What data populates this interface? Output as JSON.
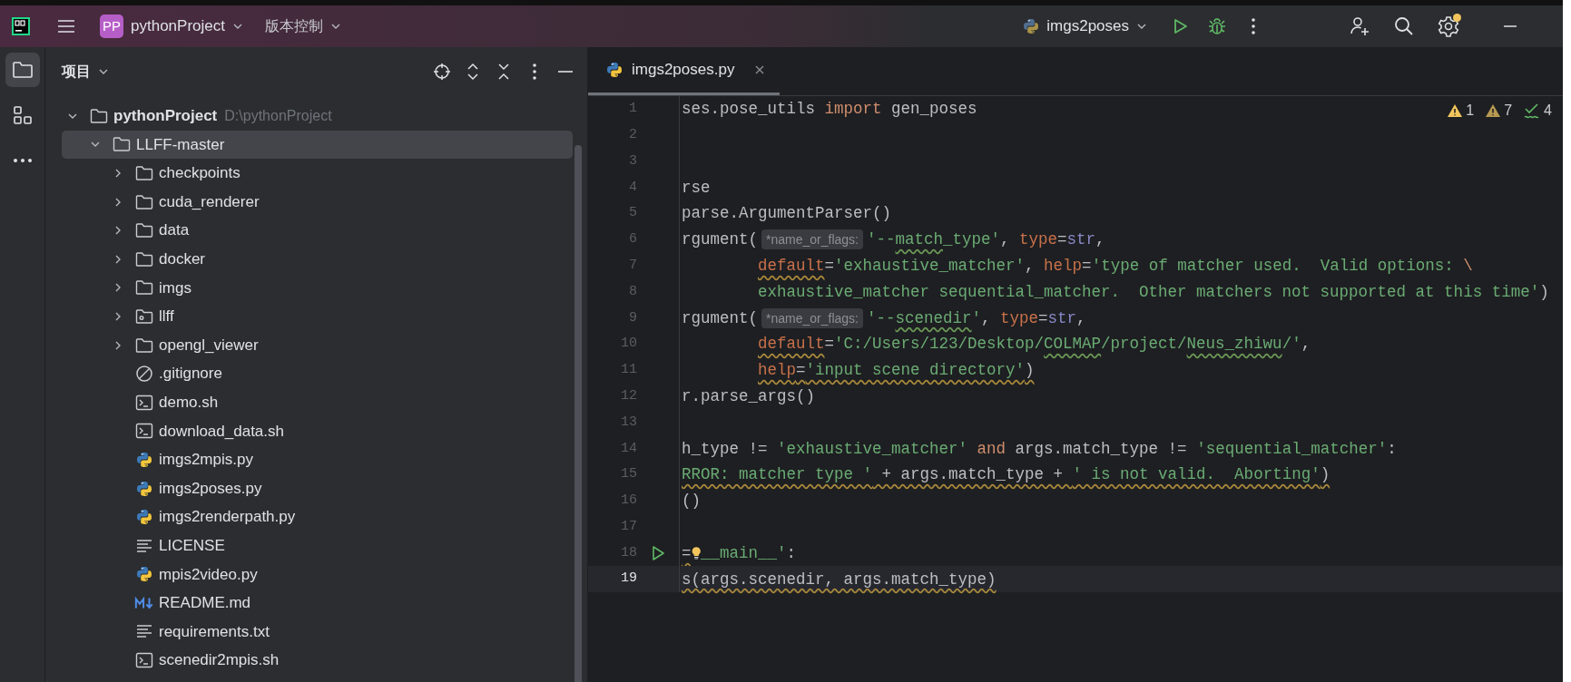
{
  "title_bar": {
    "project_badge": "PP",
    "project": "pythonProject",
    "vcs": "版本控制",
    "run_config": "imgs2poses",
    "settings_notification": true
  },
  "tool_window_strip": [
    {
      "kind": "project",
      "selected": true
    },
    {
      "kind": "structure",
      "selected": false
    },
    {
      "kind": "more",
      "selected": false
    }
  ],
  "project_panel": {
    "title": "项目",
    "tree": [
      {
        "label": "pythonProject",
        "path": "D:\\pythonProject",
        "kind": "folder",
        "expanded": true,
        "selected": false,
        "children": [
          {
            "label": "LLFF-master",
            "kind": "folder",
            "expanded": true,
            "selected": true,
            "children": [
              {
                "label": "checkpoints",
                "kind": "folder",
                "expanded": false,
                "selected": false
              },
              {
                "label": "cuda_renderer",
                "kind": "folder",
                "expanded": false,
                "selected": false
              },
              {
                "label": "data",
                "kind": "folder",
                "expanded": false,
                "selected": false
              },
              {
                "label": "docker",
                "kind": "folder",
                "expanded": false,
                "selected": false
              },
              {
                "label": "imgs",
                "kind": "folder",
                "expanded": false,
                "selected": false
              },
              {
                "label": "llff",
                "kind": "package",
                "expanded": false,
                "selected": false
              },
              {
                "label": "opengl_viewer",
                "kind": "folder",
                "expanded": false,
                "selected": false
              },
              {
                "label": ".gitignore",
                "kind": "ignore",
                "selected": false
              },
              {
                "label": "demo.sh",
                "kind": "shell",
                "selected": false
              },
              {
                "label": "download_data.sh",
                "kind": "shell",
                "selected": false
              },
              {
                "label": "imgs2mpis.py",
                "kind": "python",
                "selected": false
              },
              {
                "label": "imgs2poses.py",
                "kind": "python",
                "selected": false
              },
              {
                "label": "imgs2renderpath.py",
                "kind": "python",
                "selected": false
              },
              {
                "label": "LICENSE",
                "kind": "text",
                "selected": false
              },
              {
                "label": "mpis2video.py",
                "kind": "python",
                "selected": false
              },
              {
                "label": "README.md",
                "kind": "markdown",
                "selected": false
              },
              {
                "label": "requirements.txt",
                "kind": "text",
                "selected": false
              },
              {
                "label": "scenedir2mpis.sh",
                "kind": "shell",
                "selected": false
              }
            ]
          }
        ]
      }
    ]
  },
  "editor": {
    "tabs": [
      {
        "label": "imgs2poses.py",
        "selected": true
      }
    ],
    "inspections": [
      {
        "kind": "error",
        "count": "1"
      },
      {
        "kind": "warning",
        "count": "7"
      },
      {
        "kind": "typo",
        "count": "4"
      }
    ],
    "lines": [
      {
        "number": "1",
        "current": false,
        "run": false,
        "tokens": [
          {
            "kind": "plain",
            "text": "ses.pose_utils "
          },
          {
            "kind": "keyword",
            "text": "import"
          },
          {
            "kind": "plain",
            "text": " gen_poses"
          }
        ]
      },
      {
        "number": "2",
        "current": false,
        "run": false
      },
      {
        "number": "3",
        "current": false,
        "run": false
      },
      {
        "number": "4",
        "current": false,
        "run": false,
        "tokens": [
          {
            "kind": "plain",
            "text": "rse"
          }
        ]
      },
      {
        "number": "5",
        "current": false,
        "run": false,
        "tokens": [
          {
            "kind": "plain",
            "text": "parse.ArgumentParser()"
          }
        ]
      },
      {
        "number": "6",
        "current": false,
        "run": false,
        "tokens": [
          {
            "kind": "plain",
            "text": "rgument("
          },
          {
            "kind": "hint",
            "text": "*name_or_flags:"
          },
          {
            "kind": "string",
            "text": "'--"
          },
          {
            "kind": "string",
            "text": "match",
            "typo_underline": true
          },
          {
            "kind": "string",
            "text": "_type'"
          },
          {
            "kind": "plain",
            "text": ", "
          },
          {
            "kind": "param",
            "text": "type"
          },
          {
            "kind": "plain",
            "text": "="
          },
          {
            "kind": "builtin",
            "text": "str"
          },
          {
            "kind": "plain",
            "text": ","
          }
        ]
      },
      {
        "number": "7",
        "current": false,
        "run": false,
        "continuation": true,
        "tokens": [
          {
            "kind": "param",
            "text": "default",
            "warning_underline": true
          },
          {
            "kind": "plain",
            "text": "="
          },
          {
            "kind": "string",
            "text": "'exhaustive_matcher'"
          },
          {
            "kind": "plain",
            "text": ", "
          },
          {
            "kind": "param",
            "text": "help"
          },
          {
            "kind": "plain",
            "text": "="
          },
          {
            "kind": "string",
            "text": "'type of matcher used.  Valid options: "
          },
          {
            "kind": "escape",
            "text": "\\"
          }
        ]
      },
      {
        "number": "8",
        "current": false,
        "run": false,
        "continuation": true,
        "tokens": [
          {
            "kind": "string",
            "text": "exhaustive_matcher sequential_matcher.  Other matchers not supported at this time'"
          },
          {
            "kind": "plain",
            "text": ")"
          }
        ]
      },
      {
        "number": "9",
        "current": false,
        "run": false,
        "tokens": [
          {
            "kind": "plain",
            "text": "rgument("
          },
          {
            "kind": "hint",
            "text": "*name_or_flags:"
          },
          {
            "kind": "string",
            "text": "'--"
          },
          {
            "kind": "string",
            "text": "scenedir",
            "typo_underline": true
          },
          {
            "kind": "string",
            "text": "'"
          },
          {
            "kind": "plain",
            "text": ", "
          },
          {
            "kind": "param",
            "text": "type"
          },
          {
            "kind": "plain",
            "text": "="
          },
          {
            "kind": "builtin",
            "text": "str"
          },
          {
            "kind": "plain",
            "text": ","
          }
        ]
      },
      {
        "number": "10",
        "current": false,
        "run": false,
        "continuation": true,
        "tokens": [
          {
            "kind": "param",
            "text": "default",
            "warning_underline": true
          },
          {
            "kind": "plain",
            "text": "="
          },
          {
            "kind": "string",
            "text": "'C:/Users/123/Desktop/"
          },
          {
            "kind": "string",
            "text": "COLMAP",
            "typo_underline": true
          },
          {
            "kind": "string",
            "text": "/project/"
          },
          {
            "kind": "string",
            "text": "Neus_zhiwu",
            "typo_underline": true
          },
          {
            "kind": "string",
            "text": "/'"
          },
          {
            "kind": "plain",
            "text": ","
          }
        ]
      },
      {
        "number": "11",
        "current": false,
        "run": false,
        "continuation": true,
        "tokens": [
          {
            "kind": "param",
            "text": "help",
            "warning_underline": true
          },
          {
            "kind": "plain",
            "text": "=",
            "warning_underline": true
          },
          {
            "kind": "string",
            "text": "'input scene directory'",
            "warning_underline": true
          },
          {
            "kind": "plain",
            "text": ")",
            "warning_underline": true
          }
        ]
      },
      {
        "number": "12",
        "current": false,
        "run": false,
        "tokens": [
          {
            "kind": "plain",
            "text": "r.parse_args()"
          }
        ]
      },
      {
        "number": "13",
        "current": false,
        "run": false
      },
      {
        "number": "14",
        "current": false,
        "run": false,
        "tokens": [
          {
            "kind": "plain",
            "text": "h_type != "
          },
          {
            "kind": "string",
            "text": "'exhaustive_matcher'"
          },
          {
            "kind": "keyword",
            "text": " and"
          },
          {
            "kind": "plain",
            "text": " args.match_type != "
          },
          {
            "kind": "string",
            "text": "'sequential_matcher'"
          },
          {
            "kind": "plain",
            "text": ":"
          }
        ]
      },
      {
        "number": "15",
        "current": false,
        "run": false,
        "tokens": [
          {
            "kind": "string",
            "text": "RROR: matcher type '",
            "warning_underline": true
          },
          {
            "kind": "plain",
            "text": " + args.match_type + ",
            "warning_underline": true
          },
          {
            "kind": "string",
            "text": "' is not valid.  Aborting'",
            "warning_underline": true
          },
          {
            "kind": "plain",
            "text": ")",
            "warning_underline": true
          }
        ]
      },
      {
        "number": "16",
        "current": false,
        "run": false,
        "tokens": [
          {
            "kind": "plain",
            "text": "()"
          }
        ]
      },
      {
        "number": "17",
        "current": false,
        "run": false
      },
      {
        "number": "18",
        "current": false,
        "run": true,
        "tokens": [
          {
            "kind": "plain",
            "text": "=",
            "warning_underline": true
          },
          {
            "kind": "bulb"
          },
          {
            "kind": "string",
            "text": "__main__'"
          },
          {
            "kind": "plain",
            "text": ":"
          }
        ]
      },
      {
        "number": "19",
        "current": true,
        "run": false,
        "tokens": [
          {
            "kind": "plain",
            "text": "s(args.scenedir, args.match_type)",
            "warning_underline": true
          }
        ]
      }
    ]
  }
}
